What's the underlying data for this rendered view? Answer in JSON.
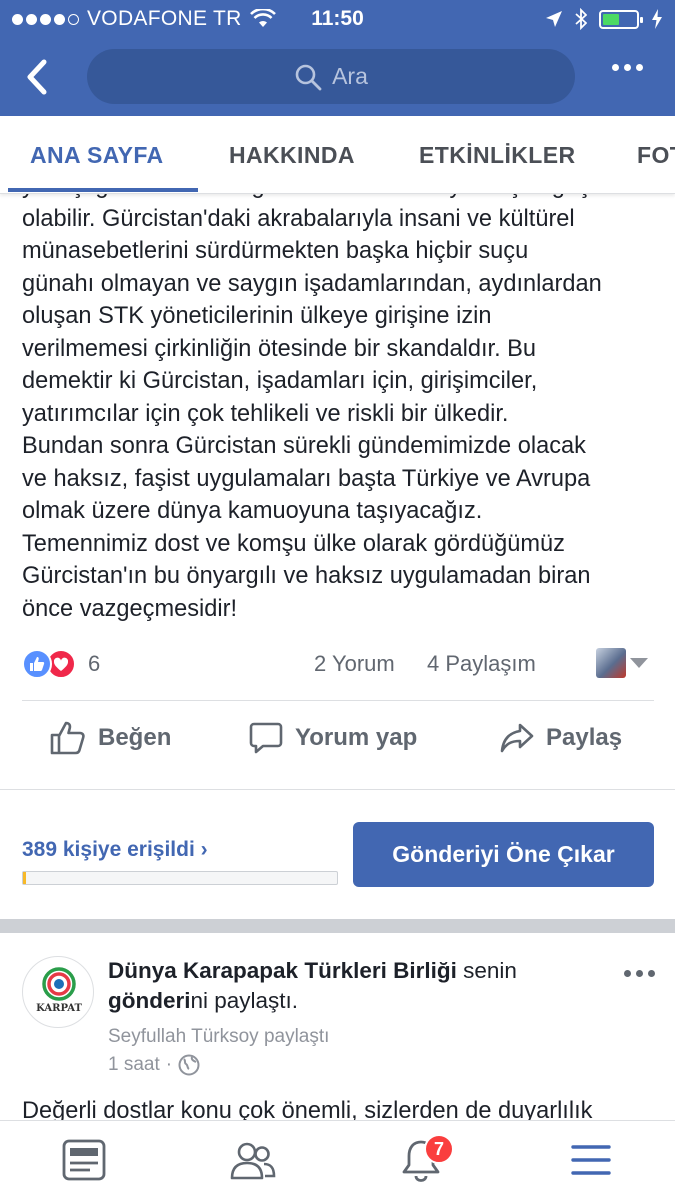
{
  "status_bar": {
    "carrier": "VODAFONE TR",
    "time": "11:50",
    "battery_level": 0.52
  },
  "header": {
    "search_placeholder": "Ara"
  },
  "tabs": [
    {
      "label": "ANA SAYFA",
      "active": true
    },
    {
      "label": "HAKKINDA"
    },
    {
      "label": "ETKİNLİKLER"
    },
    {
      "label": "FOT"
    }
  ],
  "post": {
    "text_lines": [
      "yanlışlığa dur demesi gerekir. Aksi halde yarın çok geç",
      "olabilir. Gürcistan'daki akrabalarıyla insani ve kültürel",
      "münasebetlerini sürdürmekten başka hiçbir suçu",
      "günahı olmayan ve saygın işadamlarından, aydınlardan",
      "oluşan STK yöneticilerinin ülkeye girişine izin",
      "verilmemesi çirkinliğin ötesinde bir skandaldır. Bu",
      "demektir ki Gürcistan, işadamları için, girişimciler,",
      "yatırımcılar için çok tehlikeli ve riskli bir ülkedir.",
      "Bundan sonra Gürcistan sürekli gündemimizde olacak",
      "ve haksız, faşist uygulamaları başta Türkiye  ve Avrupa",
      "olmak üzere dünya kamuoyuna taşıyacağız.",
      "Temennimiz dost ve komşu ülke olarak gördüğümüz",
      "Gürcistan'ın bu önyargılı ve haksız uygulamadan biran",
      "önce vazgeçmesidir!"
    ],
    "reaction_count": "6",
    "comments": "2 Yorum",
    "shares": "4 Paylaşım",
    "actions": {
      "like": "Beğen",
      "comment": "Yorum yap",
      "share": "Paylaş"
    },
    "reach": "389 kişiye erişildi",
    "reach_progress": 0.01,
    "boost_label": "Gönderiyi Öne Çıkar"
  },
  "post2": {
    "page_name": "Dünya Karapapak Türkleri Birliği",
    "text_mid": " senin ",
    "link_word": "gönderi",
    "text_end": "ni paylaştı.",
    "shared_by": "Seyfullah Türksoy paylaştı",
    "time": "1 saat",
    "time_sep": "·",
    "logo_text": "KARPAT",
    "text": "Değerli dostlar konu çok önemli, sizlerden de duyarlılık"
  },
  "bottom_nav": {
    "notifications_badge": "7"
  },
  "colors": {
    "brand_blue": "#4267b2",
    "search_bg": "#365899",
    "badge_red": "#fa3e3e",
    "love_red": "#f0284a",
    "like_blue": "#5890ff"
  }
}
